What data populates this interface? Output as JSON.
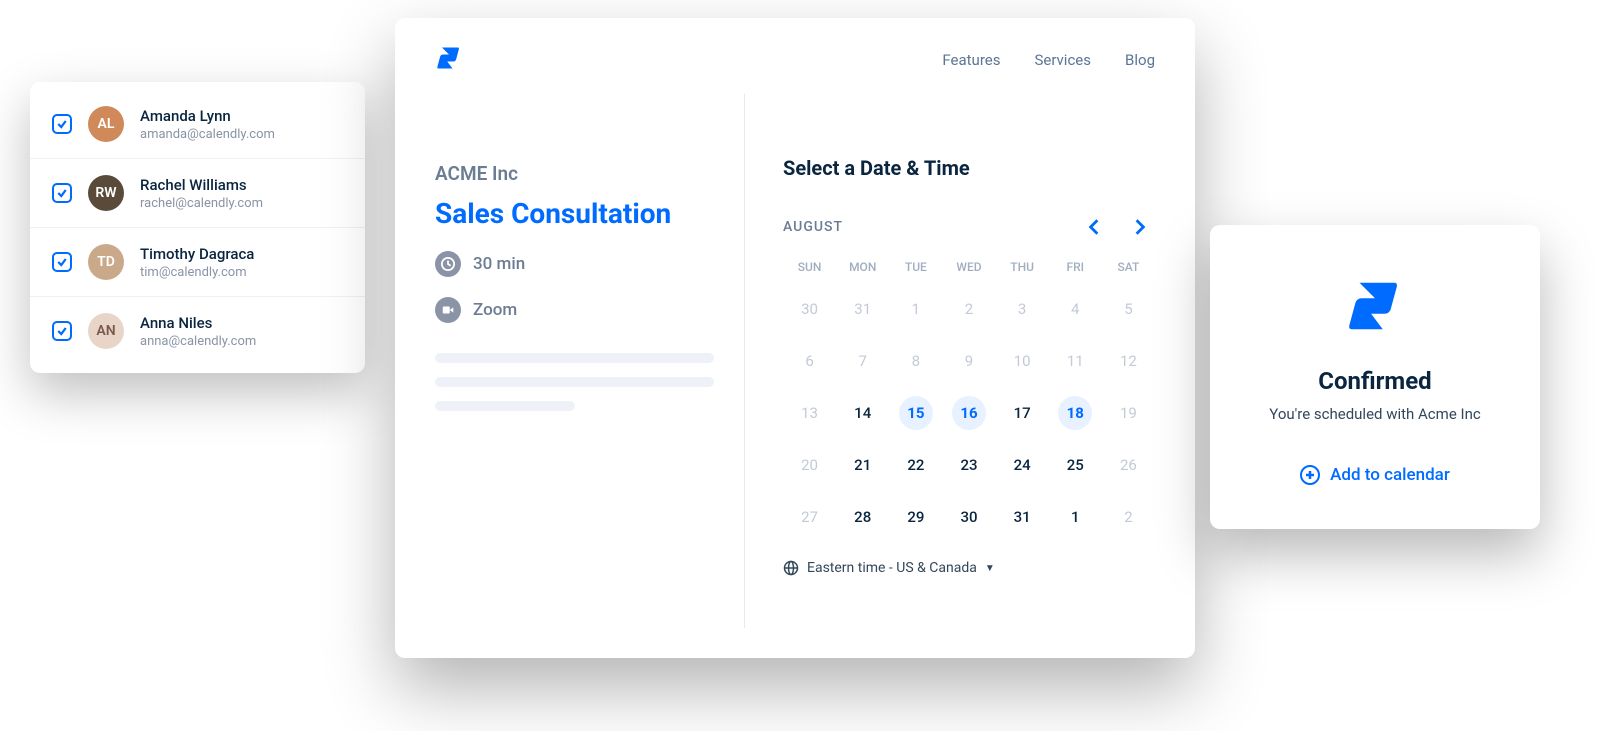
{
  "users": [
    {
      "name": "Amanda Lynn",
      "email": "amanda@calendly.com",
      "color": "#d08a5a"
    },
    {
      "name": "Rachel Williams",
      "email": "rachel@calendly.com",
      "color": "#5a4a3a"
    },
    {
      "name": "Timothy Dagraca",
      "email": "tim@calendly.com",
      "color": "#c9a98a"
    },
    {
      "name": "Anna Niles",
      "email": "anna@calendly.com",
      "color": "#e8d5c8"
    }
  ],
  "nav": {
    "features": "Features",
    "services": "Services",
    "blog": "Blog"
  },
  "event": {
    "company": "ACME Inc",
    "title": "Sales Consultation",
    "duration": "30 min",
    "location": "Zoom"
  },
  "calendar": {
    "select_title": "Select a Date & Time",
    "month": "AUGUST",
    "dow": [
      "SUN",
      "MON",
      "TUE",
      "WED",
      "THU",
      "FRI",
      "SAT"
    ],
    "cells": [
      {
        "n": "30",
        "s": "muted"
      },
      {
        "n": "31",
        "s": "muted"
      },
      {
        "n": "1",
        "s": "muted"
      },
      {
        "n": "2",
        "s": "muted"
      },
      {
        "n": "3",
        "s": "muted"
      },
      {
        "n": "4",
        "s": "muted"
      },
      {
        "n": "5",
        "s": "muted"
      },
      {
        "n": "6",
        "s": "muted"
      },
      {
        "n": "7",
        "s": "muted"
      },
      {
        "n": "8",
        "s": "muted"
      },
      {
        "n": "9",
        "s": "muted"
      },
      {
        "n": "10",
        "s": "muted"
      },
      {
        "n": "11",
        "s": "muted"
      },
      {
        "n": "12",
        "s": "muted"
      },
      {
        "n": "13",
        "s": "muted"
      },
      {
        "n": "14",
        "s": "normal"
      },
      {
        "n": "15",
        "s": "avail"
      },
      {
        "n": "16",
        "s": "avail"
      },
      {
        "n": "17",
        "s": "normal"
      },
      {
        "n": "18",
        "s": "avail"
      },
      {
        "n": "19",
        "s": "muted"
      },
      {
        "n": "20",
        "s": "muted"
      },
      {
        "n": "21",
        "s": "normal"
      },
      {
        "n": "22",
        "s": "normal"
      },
      {
        "n": "23",
        "s": "normal"
      },
      {
        "n": "24",
        "s": "normal"
      },
      {
        "n": "25",
        "s": "normal"
      },
      {
        "n": "26",
        "s": "muted"
      },
      {
        "n": "27",
        "s": "muted"
      },
      {
        "n": "28",
        "s": "normal"
      },
      {
        "n": "29",
        "s": "normal"
      },
      {
        "n": "30",
        "s": "normal"
      },
      {
        "n": "31",
        "s": "normal"
      },
      {
        "n": "1",
        "s": "normal"
      },
      {
        "n": "2",
        "s": "muted"
      }
    ],
    "timezone": "Eastern time - US & Canada"
  },
  "confirm": {
    "title": "Confirmed",
    "subtitle": "You're scheduled with Acme Inc",
    "add": "Add to calendar"
  }
}
